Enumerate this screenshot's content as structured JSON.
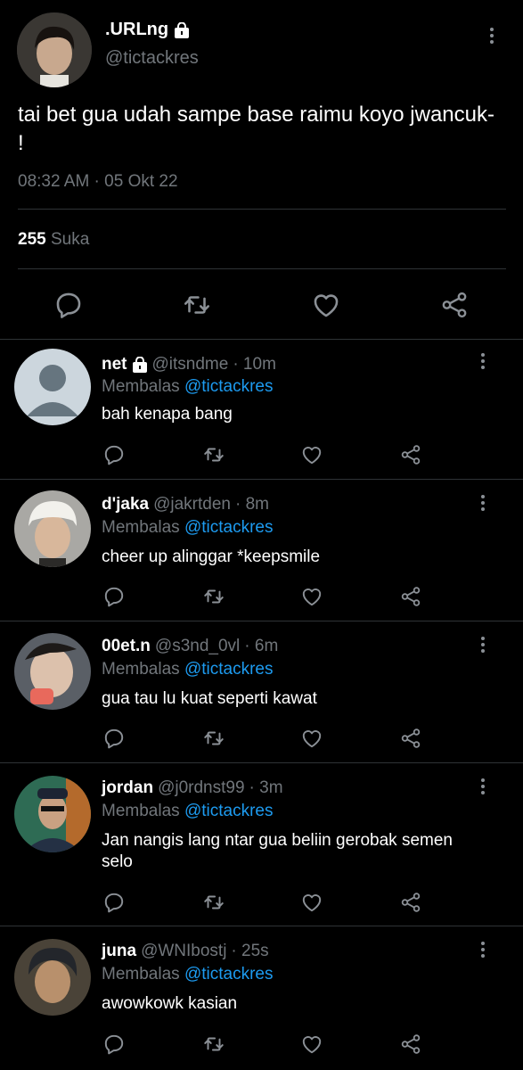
{
  "main": {
    "name": ".URLng",
    "handle": "@tictackres",
    "text": "tai bet gua udah sampe base raimu koyo jwancuk- !",
    "time": "08:32 AM · 05 Okt 22",
    "likes_count": "255",
    "likes_label": "Suka"
  },
  "replies": [
    {
      "name": "net",
      "handle": "@itsndme",
      "age": "· 10m",
      "replying": "Membalas",
      "to": "@tictackres",
      "text": "bah kenapa bang"
    },
    {
      "name": "d'jaka",
      "handle": "@jakrtden",
      "age": "· 8m",
      "replying": "Membalas",
      "to": "@tictackres",
      "text": "cheer up alinggar *keepsmile"
    },
    {
      "name": "00et.n",
      "handle": "@s3nd_0vl",
      "age": "· 6m",
      "replying": "Membalas",
      "to": "@tictackres",
      "text": "gua tau lu kuat seperti kawat"
    },
    {
      "name": "jordan",
      "handle": "@j0rdnst99",
      "age": "· 3m",
      "replying": "Membalas",
      "to": "@tictackres",
      "text": "Jan nangis lang ntar gua beliin gerobak semen selo"
    },
    {
      "name": "juna",
      "handle": "@WNIbostj",
      "age": "· 25s",
      "replying": "Membalas",
      "to": "@tictackres",
      "text": "awowkowk kasian"
    }
  ],
  "colors": {
    "background": "#000000",
    "text": "#e7e9ea",
    "muted": "#71767b",
    "link": "#1d9bf0",
    "divider": "#2f3336"
  }
}
